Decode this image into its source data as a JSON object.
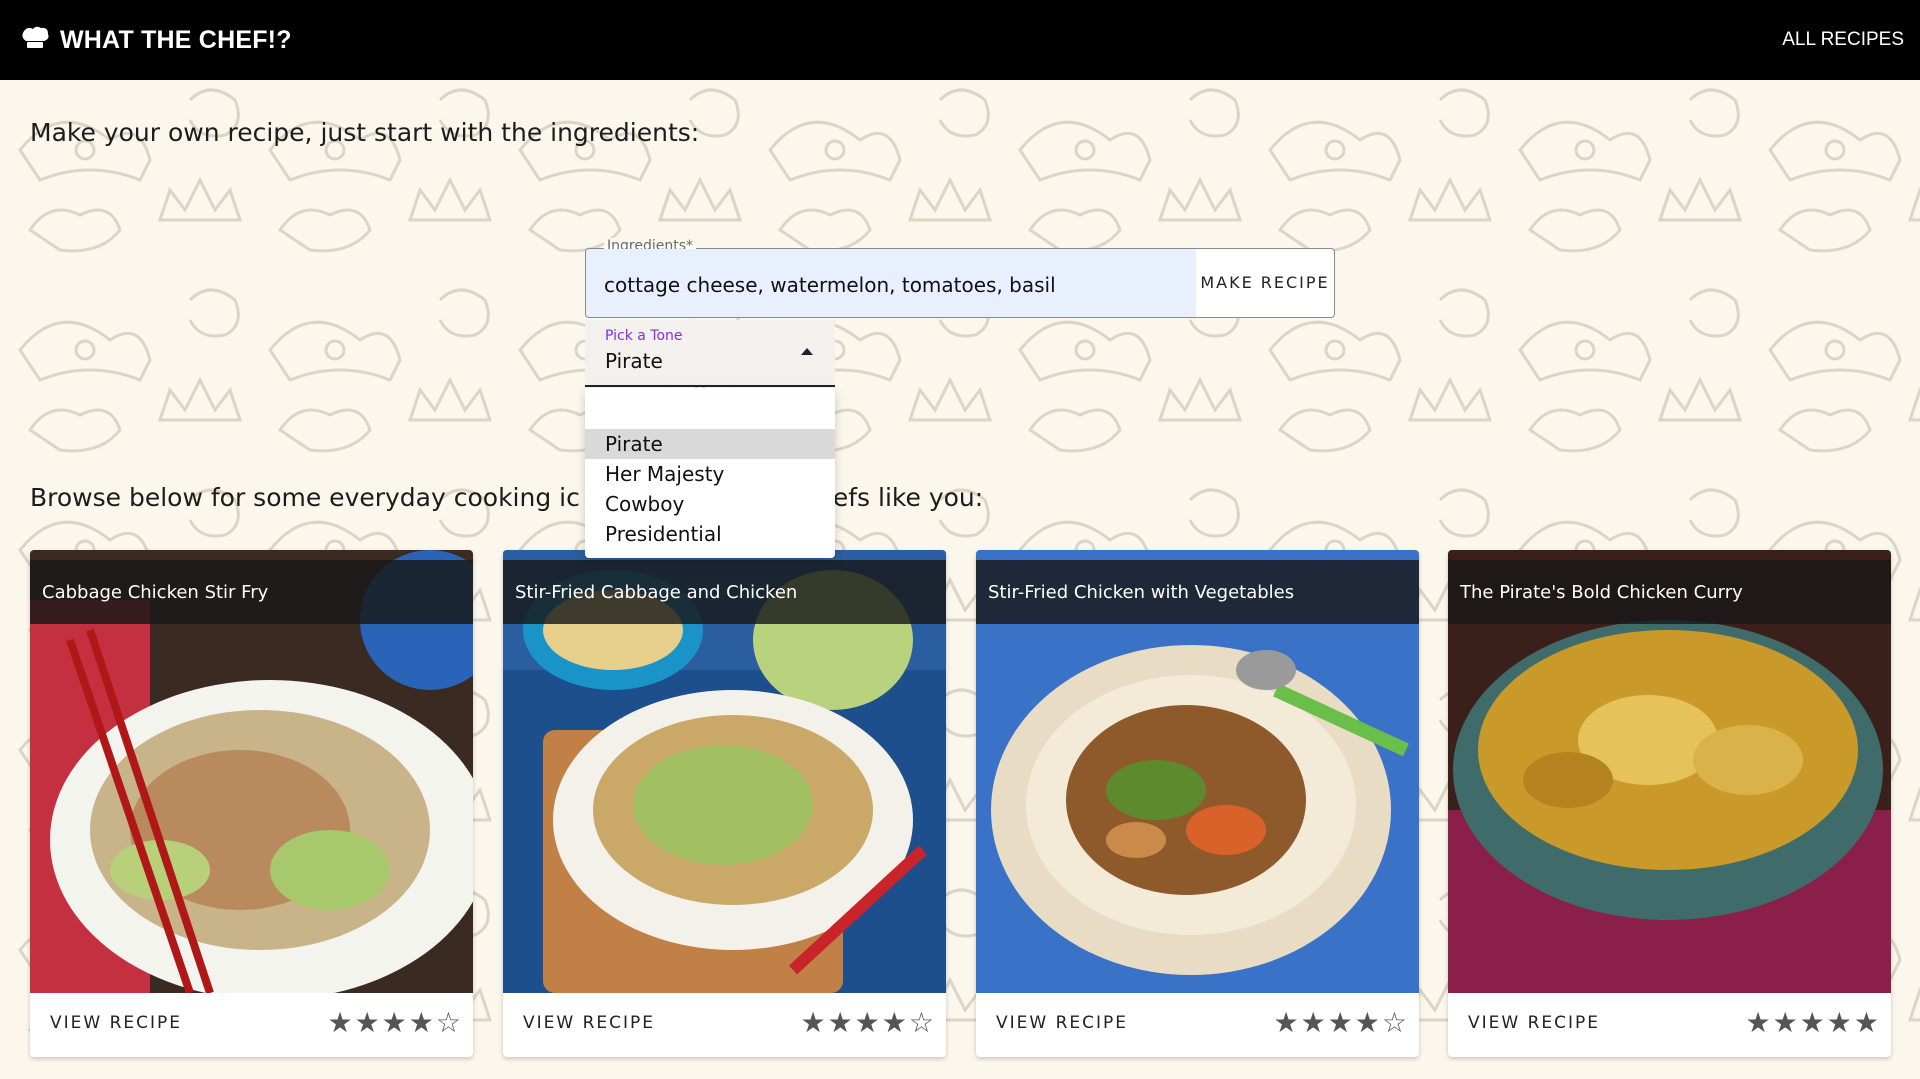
{
  "header": {
    "brand": "WHAT THE CHEF!?",
    "all_recipes": "ALL RECIPES"
  },
  "intro": "Make your own recipe, just start with the ingredients:",
  "ingredients": {
    "label": "Ingredients*",
    "value": "cottage cheese, watermelon, tomatoes, basil",
    "button_label": "MAKE RECIPE"
  },
  "tone": {
    "label": "Pick a Tone",
    "value": "Pirate",
    "options": [
      "Pirate",
      "Her Majesty",
      "Cowboy",
      "Presidential"
    ],
    "selected": "Pirate"
  },
  "browse_text_left": "Browse below for some everyday cooking ic",
  "browse_text_right": "efs like you:",
  "cards": [
    {
      "title": "Cabbage Chicken Stir Fry",
      "view_label": "VIEW RECIPE",
      "rating": 4
    },
    {
      "title": "Stir-Fried Cabbage and Chicken",
      "view_label": "VIEW RECIPE",
      "rating": 4
    },
    {
      "title": "Stir-Fried Chicken with Vegetables",
      "view_label": "VIEW RECIPE",
      "rating": 4
    },
    {
      "title": "The Pirate's Bold Chicken Curry",
      "view_label": "VIEW RECIPE",
      "rating": 5
    }
  ],
  "colors": {
    "appbar": "#000000",
    "background": "#fbf7ec",
    "tone_label": "#8a2be2",
    "input_fill": "#e8f0fe"
  }
}
